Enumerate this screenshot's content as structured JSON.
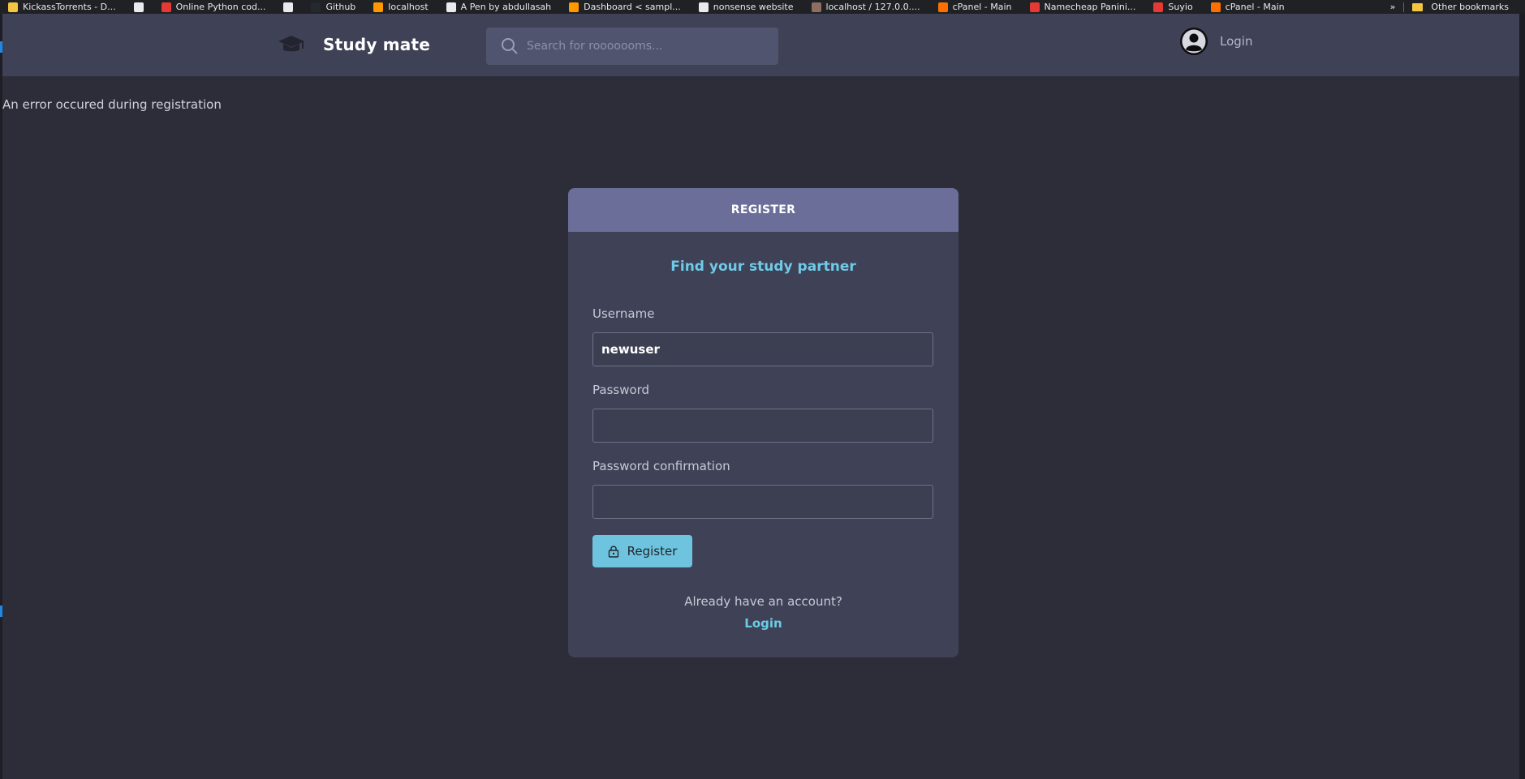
{
  "bookmarks": {
    "items": [
      {
        "label": "KickassTorrents - D...",
        "color": "#f4c542"
      },
      {
        "label": "",
        "color": "#e8eaed"
      },
      {
        "label": "Online Python cod...",
        "color": "#e53935"
      },
      {
        "label": "",
        "color": "#e8eaed"
      },
      {
        "label": "Github",
        "color": "#24292e"
      },
      {
        "label": "localhost",
        "color": "#ff9800"
      },
      {
        "label": "A Pen by abdullasah",
        "color": "#e8eaed"
      },
      {
        "label": "Dashboard < sampl...",
        "color": "#ff9800"
      },
      {
        "label": "nonsense website",
        "color": "#e8eaed"
      },
      {
        "label": "localhost / 127.0.0....",
        "color": "#8d6e63"
      },
      {
        "label": "cPanel - Main",
        "color": "#ff6f00"
      },
      {
        "label": "Namecheap Panini...",
        "color": "#e53935"
      },
      {
        "label": "Suyio",
        "color": "#e53935"
      },
      {
        "label": "cPanel - Main",
        "color": "#ff6f00"
      }
    ],
    "more": "»",
    "other_bookmarks": "Other bookmarks"
  },
  "navbar": {
    "logo_icon": "graduation-cap-icon",
    "brand": "Study mate",
    "search_placeholder": "Search for rooooooms...",
    "login_label": "Login",
    "avatar_icon": "user-circle-icon"
  },
  "error_message": "An error occured during registration",
  "register_card": {
    "header": "REGISTER",
    "subtitle": "Find your study partner",
    "username_label": "Username",
    "username_value": "newuser",
    "password_label": "Password",
    "password_value": "",
    "password_confirmation_label": "Password confirmation",
    "password_confirmation_value": "",
    "register_button": "Register",
    "register_icon": "lock-icon",
    "account_prompt": "Already have an account?",
    "login_link": "Login"
  },
  "colors": {
    "background": "#2d2d39",
    "navbar": "#3f4156",
    "card_header": "#6b6e98",
    "accent": "#6ecbe6",
    "button": "#6ec4de"
  }
}
